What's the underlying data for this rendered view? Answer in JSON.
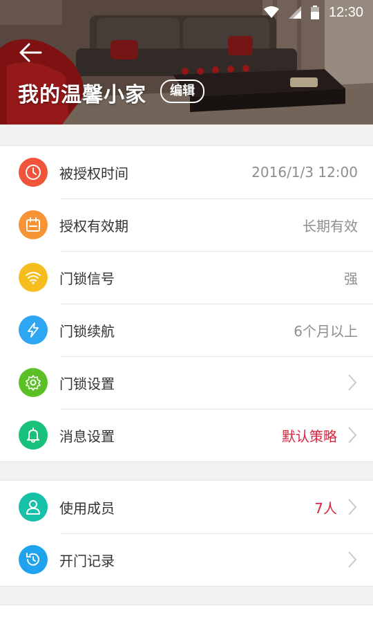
{
  "status_bar": {
    "time": "12:30",
    "icons": [
      "wifi-icon",
      "cellular-signal-icon",
      "battery-icon"
    ]
  },
  "header": {
    "title": "我的温馨小家",
    "edit_label": "编辑",
    "back_icon": "back-arrow-icon"
  },
  "info_list": [
    {
      "label": "被授权时间",
      "value": "2016/1/3  12:00",
      "icon": "clock-icon",
      "color": "#f0553c"
    },
    {
      "label": "授权有效期",
      "value": "长期有效",
      "icon": "calendar-icon",
      "color": "#f79436"
    },
    {
      "label": "门锁信号",
      "value": "强",
      "icon": "wifi-icon",
      "color": "#f6bd1e"
    },
    {
      "label": "门锁续航",
      "value": "6个月以上",
      "icon": "lightning-icon",
      "color": "#2fa6f1"
    },
    {
      "label": "门锁设置",
      "value": "",
      "icon": "gear-icon",
      "color": "#5ac026"
    },
    {
      "label": "消息设置",
      "value": "默认策略",
      "icon": "bell-icon",
      "color": "#18c27d"
    }
  ],
  "member_list": [
    {
      "label": "使用成员",
      "value": "7人",
      "icon": "person-icon",
      "color": "#17c1a8"
    },
    {
      "label": "开门记录",
      "value": "",
      "icon": "history-icon",
      "color": "#1fa3ef"
    }
  ],
  "colors": {
    "accent_red": "#d8263e",
    "value_gray": "#8e8e8e"
  }
}
